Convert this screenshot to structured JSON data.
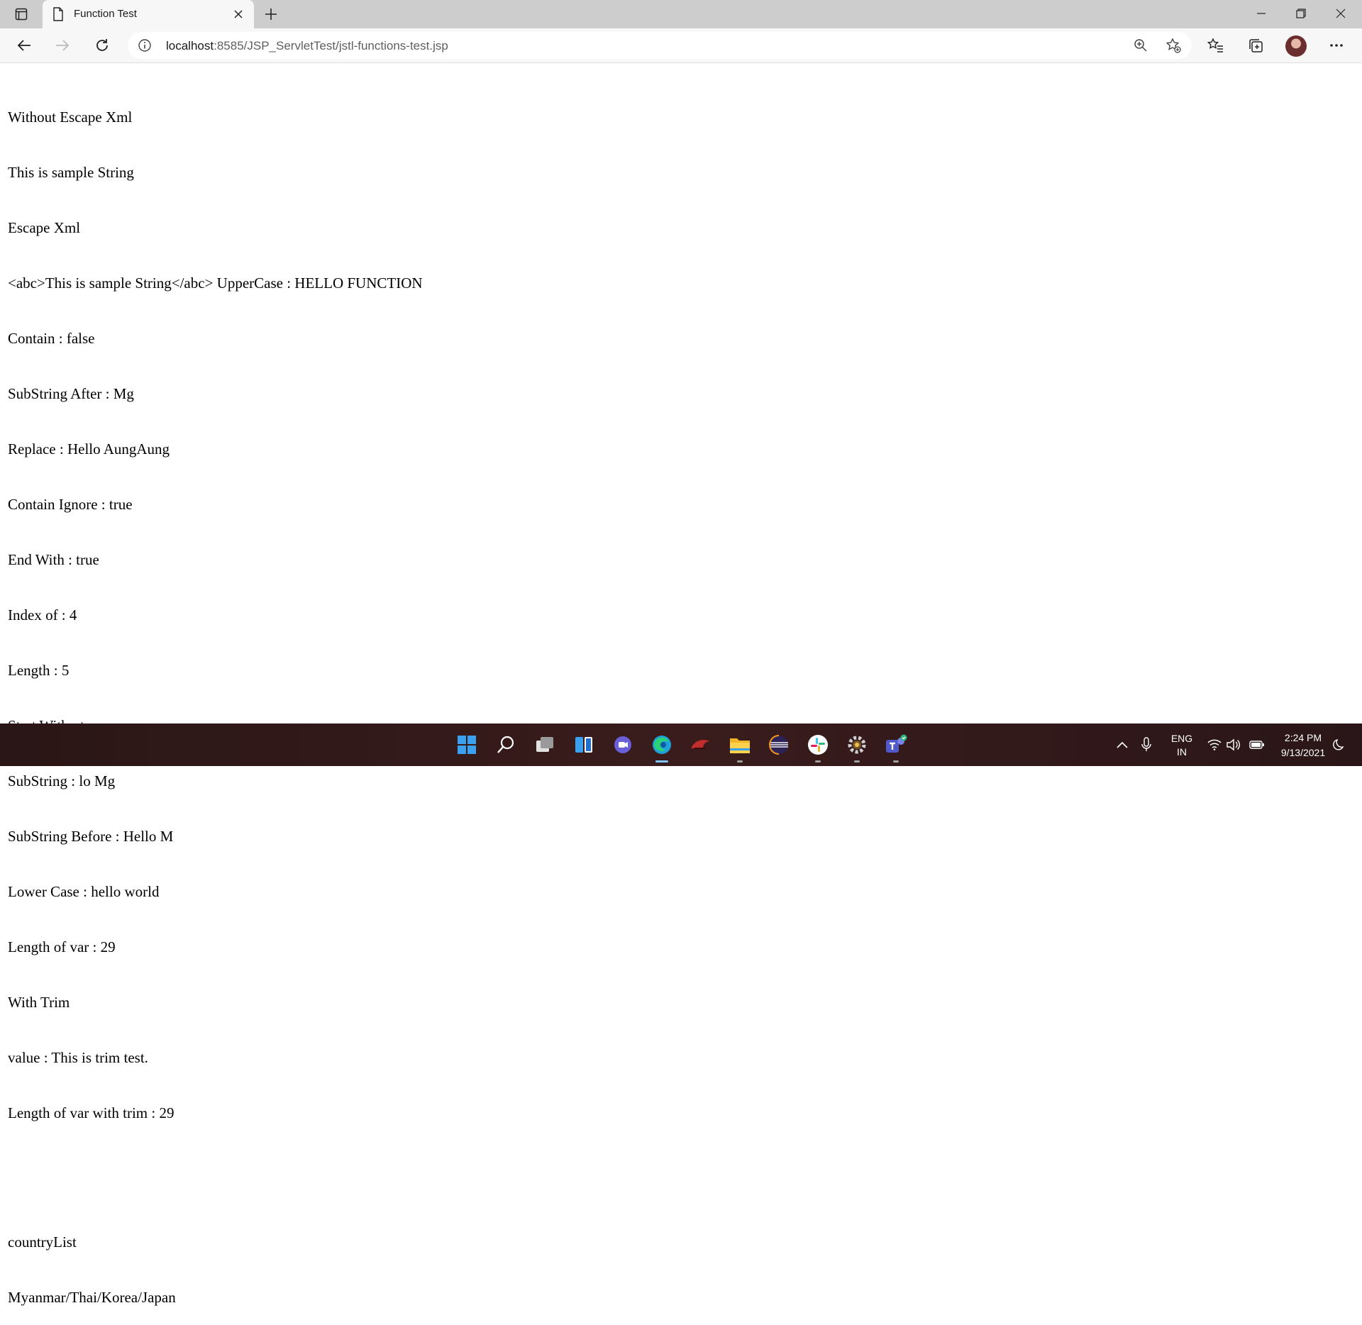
{
  "browser": {
    "tab_title": "Function Test",
    "url_host": "localhost",
    "url_path": ":8585/JSP_ServletTest/jstl-functions-test.jsp"
  },
  "page": {
    "lines": [
      "Without Escape Xml",
      "This is sample String",
      "Escape Xml",
      "<abc>This is sample String</abc> UpperCase : HELLO FUNCTION",
      "Contain : false",
      "SubString After : Mg",
      "Replace : Hello AungAung",
      "Contain Ignore : true",
      "End With : true",
      "Index of : 4",
      "Length : 5",
      "Start With : true",
      "SubString : lo Mg",
      "SubString Before : Hello M",
      "Lower Case : hello world",
      "Length of var : 29",
      "With Trim",
      "value : This is trim test.",
      "Length of var with trim : 29"
    ],
    "list_title": "countryList",
    "list_value": "Myanmar/Thai/Korea/Japan"
  },
  "taskbar": {
    "lang_line1": "ENG",
    "lang_line2": "IN",
    "time": "2:24 PM",
    "date": "9/13/2021"
  },
  "colors": {
    "tabstrip": "#cdcdcd",
    "toolbar": "#f7f7f7",
    "taskbar": "#2f1a1a"
  }
}
